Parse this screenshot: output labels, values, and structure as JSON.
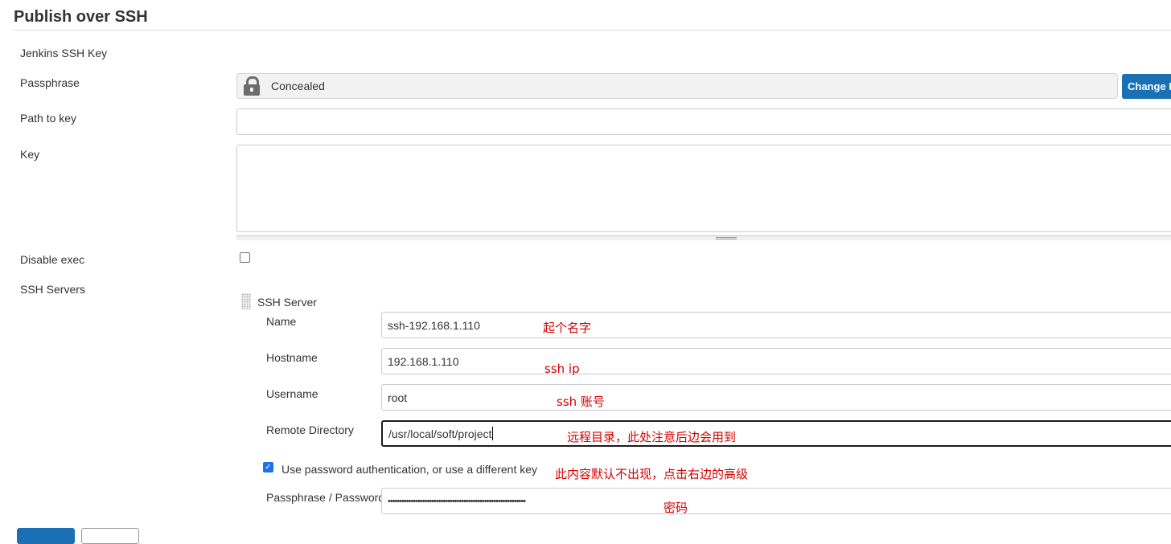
{
  "section": {
    "title": "Publish over SSH"
  },
  "fields": {
    "jenkins_ssh_key_label": "Jenkins SSH Key",
    "passphrase_label": "Passphrase",
    "passphrase_value": "Concealed",
    "change_button": "Change Passphrase",
    "path_to_key_label": "Path to key",
    "path_to_key_value": "",
    "key_label": "Key",
    "key_value": "",
    "disable_exec_label": "Disable exec",
    "disable_exec_checked": false,
    "ssh_servers_label": "SSH Servers"
  },
  "ssh_server": {
    "heading": "SSH Server",
    "name_label": "Name",
    "name_value": "ssh-192.168.1.110",
    "hostname_label": "Hostname",
    "hostname_value": "192.168.1.110",
    "username_label": "Username",
    "username_value": "root",
    "remote_dir_label": "Remote Directory",
    "remote_dir_value": "/usr/local/soft/project",
    "use_password_label": "Use password authentication, or use a different key",
    "use_password_checked": true,
    "password_label": "Passphrase / Password",
    "password_value": "••••••••••••••••••••••••••••••••••••••••••••••••••••••••••••"
  },
  "annotations": {
    "name": "起个名字",
    "hostname": "ssh ip",
    "username": "ssh 账号",
    "remote_dir": "远程目录，此处注意后边会用到",
    "use_password": "此内容默认不出现，点击右边的高级",
    "password": "密码"
  },
  "colors": {
    "accent": "#1a6fb5",
    "annotation": "#d40000",
    "checkbox": "#1a73e8"
  }
}
